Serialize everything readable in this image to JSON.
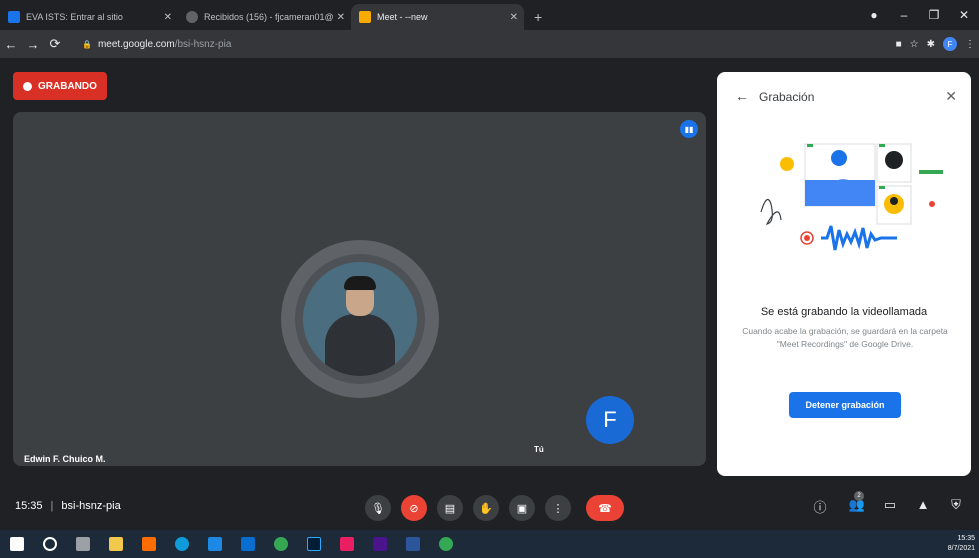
{
  "browser": {
    "tabs": [
      {
        "title": "EVA ISTS: Entrar al sitio",
        "favicon_color": "#1a73e8"
      },
      {
        "title": "Recibidos (156) - fjcameran01@",
        "favicon_color": "#5f6368"
      },
      {
        "title": "Meet - --new",
        "favicon_color": "#f9ab00",
        "active": true
      }
    ],
    "new_tab": "+",
    "address": {
      "host": "meet.google.com",
      "path": "/bsi-hsnz-pia"
    },
    "profile_letter": "F"
  },
  "recording_badge": "GRABANDO",
  "main_participant": {
    "name": "Edwin F. Chuico M."
  },
  "self_tile": {
    "avatar_letter": "F",
    "name": "Tú"
  },
  "panel": {
    "title": "Grabación",
    "heading": "Se está grabando la videollamada",
    "description": "Cuando acabe la grabación, se guardará en la carpeta \"Meet Recordings\" de Google Drive.",
    "stop_button": "Detener grabación"
  },
  "bottom_bar": {
    "time": "15:35",
    "separator": "|",
    "meeting_code": "bsi-hsnz-pia",
    "participants_count": "2",
    "icons": [
      "mic-icon",
      "camera-off-icon",
      "captions-icon",
      "raise-hand-icon",
      "present-icon",
      "more-icon",
      "hang-up-icon",
      "info-icon",
      "people-icon",
      "chat-icon",
      "activities-icon",
      "host-controls-icon"
    ]
  },
  "taskbar": {
    "clock_time": "15:35",
    "clock_date": "8/7/2021"
  },
  "colors": {
    "record_red": "#d93025",
    "meet_blue": "#1a73e8",
    "background": "#202124",
    "tile": "#3c4043"
  }
}
